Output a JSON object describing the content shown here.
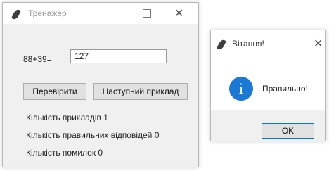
{
  "main_window": {
    "title": "Тренажер",
    "expression": "88+39=",
    "answer_value": "127",
    "check_button": "Перевірити",
    "next_button": "Наступний приклад",
    "stats": {
      "examples": "Кількість прикладів 1",
      "correct": "Кількість правильних відповідей 0",
      "errors": "Кількість помилок 0"
    }
  },
  "dialog": {
    "title": "Вітання!",
    "message": "Правильно!",
    "ok_button": "OK",
    "info_glyph": "i"
  },
  "icons": {
    "app": "feather-icon",
    "minimize": "minimize-icon",
    "maximize": "maximize-icon",
    "close": "close-icon",
    "info": "info-icon"
  },
  "colors": {
    "info_blue": "#1a78d6",
    "focus_border": "#0078d7",
    "button_face": "#e1e1e1"
  },
  "glyphs": {
    "close": "✕"
  }
}
